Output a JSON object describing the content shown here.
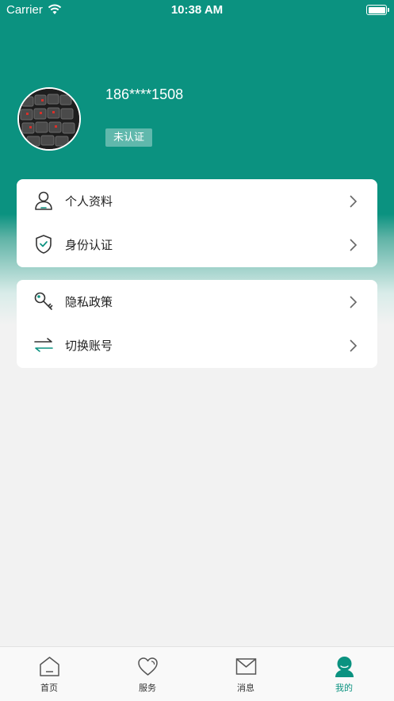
{
  "status_bar": {
    "carrier": "Carrier",
    "time": "10:38 AM"
  },
  "profile": {
    "phone": "186****1508",
    "verify_status": "未认证"
  },
  "menu_group1": [
    {
      "label": "个人资料",
      "icon": "user-icon"
    },
    {
      "label": "身份认证",
      "icon": "shield-check-icon"
    }
  ],
  "menu_group2": [
    {
      "label": "隐私政策",
      "icon": "key-icon"
    },
    {
      "label": "切换账号",
      "icon": "switch-arrows-icon"
    }
  ],
  "tabbar": {
    "active": "我的",
    "items": [
      {
        "label": "首页",
        "icon": "home-icon"
      },
      {
        "label": "服务",
        "icon": "heart-icon"
      },
      {
        "label": "消息",
        "icon": "envelope-icon"
      },
      {
        "label": "我的",
        "icon": "profile-icon"
      }
    ]
  },
  "colors": {
    "accent": "#0b9280",
    "background": "#f2f2f2"
  }
}
